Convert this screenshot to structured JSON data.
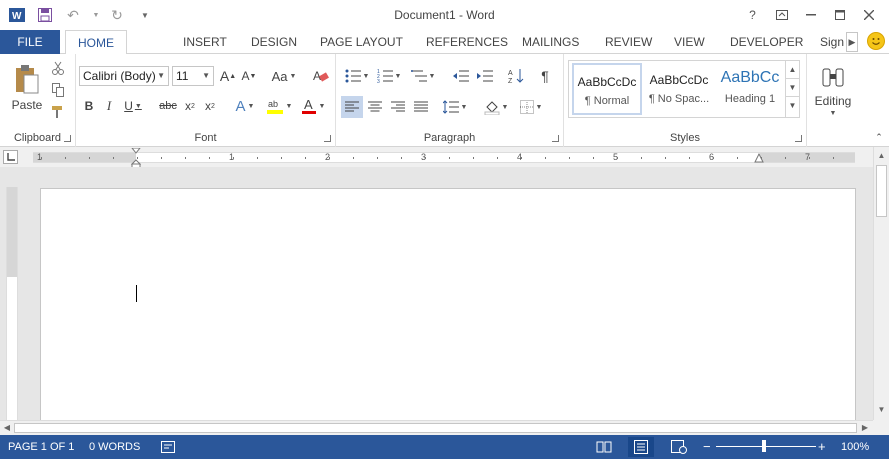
{
  "window": {
    "title": "Document1 - Word",
    "help": "?"
  },
  "tabs": {
    "file": "FILE",
    "items": [
      "HOME",
      "INSERT",
      "DESIGN",
      "PAGE LAYOUT",
      "REFERENCES",
      "MAILINGS",
      "REVIEW",
      "VIEW",
      "DEVELOPER"
    ],
    "signin": "Sign"
  },
  "ribbon": {
    "clipboard": {
      "label": "Clipboard",
      "paste": "Paste"
    },
    "font": {
      "label": "Font",
      "name": "Calibri (Body)",
      "size": "11",
      "case": "Aa"
    },
    "paragraph": {
      "label": "Paragraph"
    },
    "styles": {
      "label": "Styles",
      "items": [
        {
          "sample": "AaBbCcDc",
          "name": "¶ Normal"
        },
        {
          "sample": "AaBbCcDc",
          "name": "¶ No Spac..."
        },
        {
          "sample": "AaBbCc",
          "name": "Heading 1"
        }
      ]
    },
    "editing": {
      "label": "Editing"
    }
  },
  "ruler": {
    "numbers": [
      "1",
      "1",
      "2",
      "3",
      "4",
      "5",
      "6",
      "7"
    ]
  },
  "status": {
    "page": "PAGE 1 OF 1",
    "words": "0 WORDS",
    "zoom_minus": "−",
    "zoom_plus": "+",
    "zoom": "100%",
    "zoom_level": 100
  },
  "colors": {
    "accent": "#2b579a",
    "highlight": "#ffff00",
    "font_color": "#e00000"
  }
}
